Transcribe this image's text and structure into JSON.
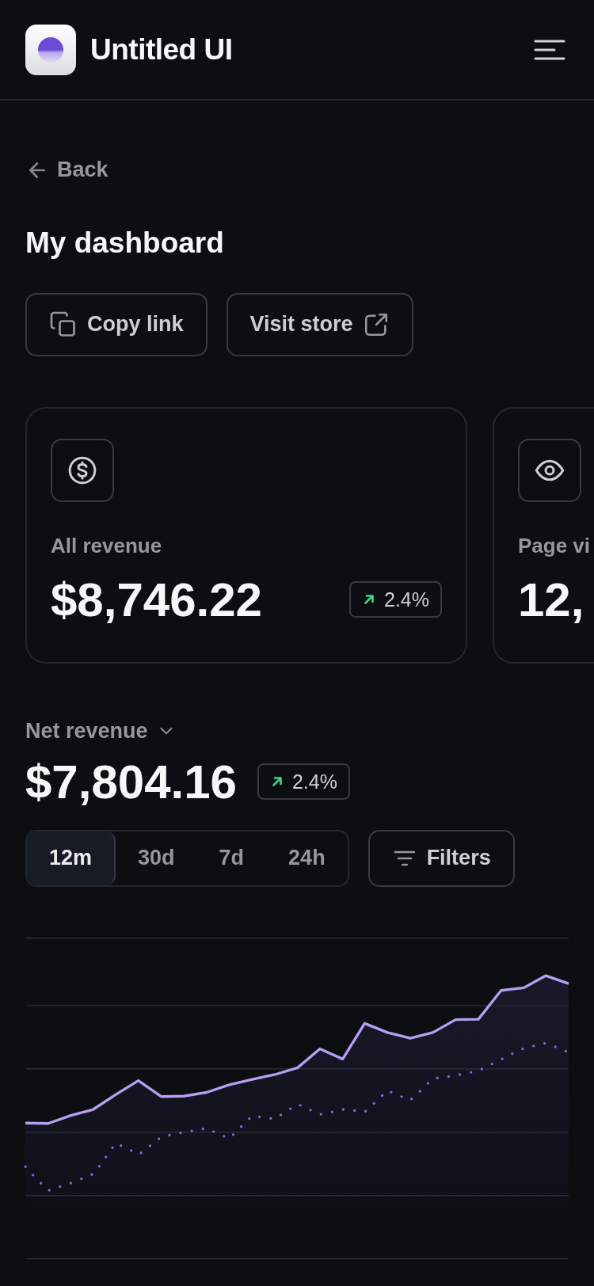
{
  "header": {
    "brand": "Untitled UI"
  },
  "back_link": "Back",
  "page_title": "My dashboard",
  "actions": [
    {
      "kind": "copy",
      "label": "Copy link"
    },
    {
      "kind": "external",
      "label": "Visit store"
    }
  ],
  "metric_cards": [
    {
      "kind": "revenue",
      "label": "All revenue",
      "value": "$8,746.22",
      "change": "2.4%"
    },
    {
      "kind": "views",
      "label": "Page vi",
      "value": "12,"
    }
  ],
  "net_revenue": {
    "label": "Net revenue",
    "value": "$7,804.16",
    "change": "2.4%"
  },
  "ranges": [
    {
      "label": "12m",
      "selected": true
    },
    {
      "label": "30d",
      "selected": false
    },
    {
      "label": "7d",
      "selected": false
    },
    {
      "label": "24h",
      "selected": false
    }
  ],
  "filters_button": "Filters"
}
